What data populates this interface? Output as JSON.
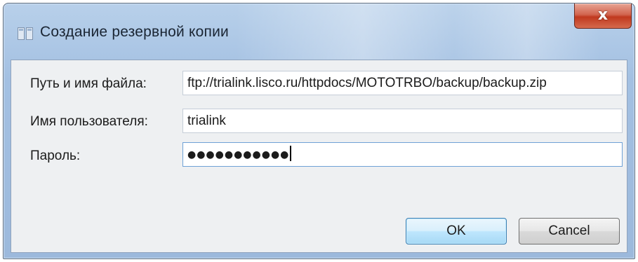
{
  "window": {
    "title": "Создание резервной копии",
    "close_label": "x"
  },
  "form": {
    "path": {
      "label": "Путь и имя файла:",
      "value": "ftp://trialink.lisco.ru/httpdocs/MOTOTRBO/backup/backup.zip"
    },
    "username": {
      "label": "Имя пользователя:",
      "value": "trialink"
    },
    "password": {
      "label": "Пароль:",
      "masked_value": "●●●●●●●●●●●"
    }
  },
  "buttons": {
    "ok_label": "OK",
    "cancel_label": "Cancel"
  },
  "icons": {
    "app": "dialog-window-icon",
    "close": "close-icon"
  },
  "colors": {
    "titlebar": "#a3c0e2",
    "close_button": "#c0391f",
    "client_background": "#eef0f2",
    "focus_border": "#6fa1d6"
  }
}
